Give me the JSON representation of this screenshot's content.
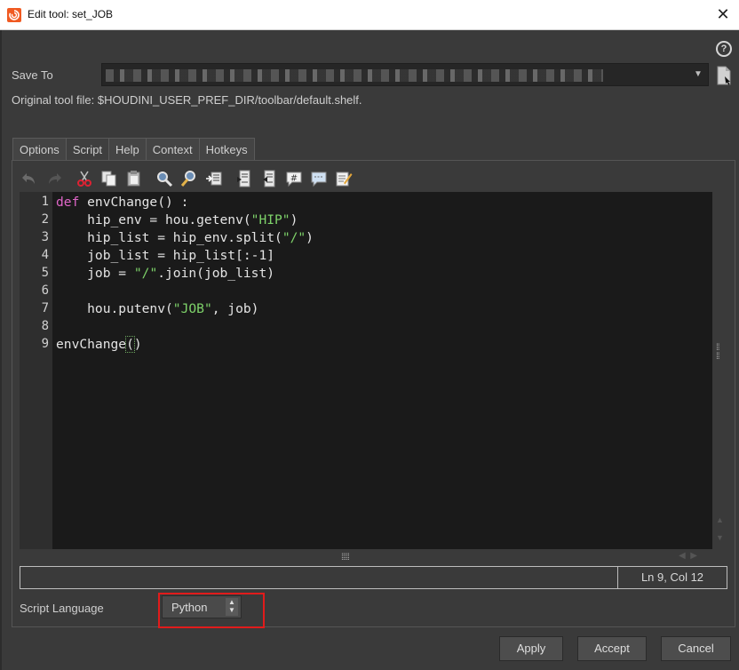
{
  "window": {
    "title": "Edit tool: set_JOB",
    "close_glyph": "✕"
  },
  "help_glyph": "?",
  "save_to": {
    "label": "Save To"
  },
  "original_tool_file": {
    "label": "Original tool file:",
    "path": "$HOUDINI_USER_PREF_DIR/toolbar/default.shelf."
  },
  "tabs": [
    {
      "label": "Options",
      "active": false
    },
    {
      "label": "Script",
      "active": true
    },
    {
      "label": "Help",
      "active": false
    },
    {
      "label": "Context",
      "active": false
    },
    {
      "label": "Hotkeys",
      "active": false
    }
  ],
  "toolbar_icons": [
    "undo-icon",
    "redo-icon",
    "cut-icon",
    "copy-icon",
    "paste-icon",
    "find-icon",
    "find-replace-icon",
    "goto-line-icon",
    "indent-icon",
    "unindent-icon",
    "comment-icon",
    "uncomment-icon",
    "edit-external-icon"
  ],
  "code": {
    "line_numbers": [
      "1",
      "2",
      "3",
      "4",
      "5",
      "6",
      "7",
      "8",
      "9"
    ],
    "lines": [
      [
        {
          "t": "kw",
          "v": "def"
        },
        {
          "t": "p",
          "v": " envChange() :"
        }
      ],
      [
        {
          "t": "p",
          "v": "    hip_env = hou.getenv("
        },
        {
          "t": "s",
          "v": "\"HIP\""
        },
        {
          "t": "p",
          "v": ")"
        }
      ],
      [
        {
          "t": "p",
          "v": "    hip_list = hip_env.split("
        },
        {
          "t": "s",
          "v": "\"/\""
        },
        {
          "t": "p",
          "v": ")"
        }
      ],
      [
        {
          "t": "p",
          "v": "    job_list = hip_list[:-1]"
        }
      ],
      [
        {
          "t": "p",
          "v": "    job = "
        },
        {
          "t": "s",
          "v": "\"/\""
        },
        {
          "t": "p",
          "v": ".join(job_list)"
        }
      ],
      [],
      [
        {
          "t": "p",
          "v": "    hou.putenv("
        },
        {
          "t": "s",
          "v": "\"JOB\""
        },
        {
          "t": "p",
          "v": ", job)"
        }
      ],
      [],
      [
        {
          "t": "p",
          "v": "envChange"
        },
        {
          "t": "hl",
          "v": "("
        },
        {
          "t": "p",
          "v": ")"
        }
      ]
    ]
  },
  "status": {
    "position": "Ln 9, Col 12"
  },
  "script_language": {
    "label": "Script Language",
    "value": "Python"
  },
  "buttons": {
    "apply": "Apply",
    "accept": "Accept",
    "cancel": "Cancel"
  }
}
